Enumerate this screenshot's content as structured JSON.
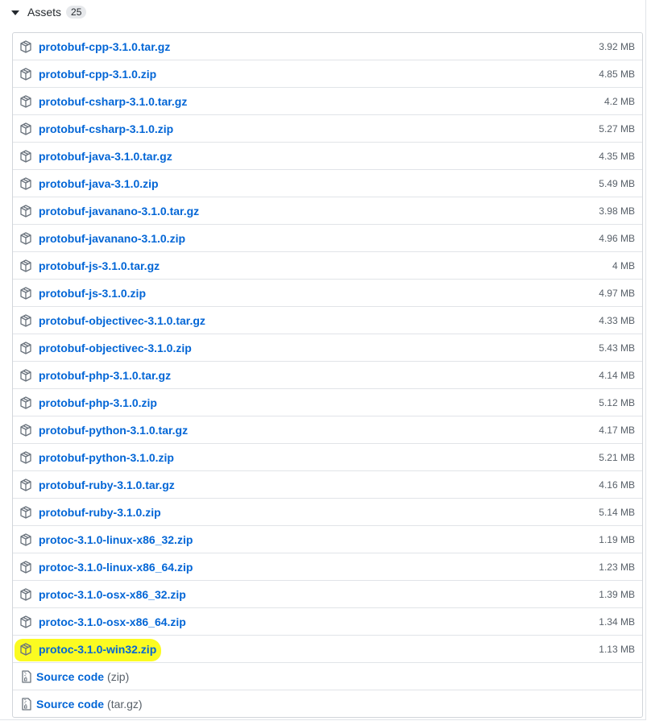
{
  "assets": {
    "title": "Assets",
    "count": "25",
    "items": [
      {
        "name": "protobuf-cpp-3.1.0.tar.gz",
        "size": "3.92 MB"
      },
      {
        "name": "protobuf-cpp-3.1.0.zip",
        "size": "4.85 MB"
      },
      {
        "name": "protobuf-csharp-3.1.0.tar.gz",
        "size": "4.2 MB"
      },
      {
        "name": "protobuf-csharp-3.1.0.zip",
        "size": "5.27 MB"
      },
      {
        "name": "protobuf-java-3.1.0.tar.gz",
        "size": "4.35 MB"
      },
      {
        "name": "protobuf-java-3.1.0.zip",
        "size": "5.49 MB"
      },
      {
        "name": "protobuf-javanano-3.1.0.tar.gz",
        "size": "3.98 MB"
      },
      {
        "name": "protobuf-javanano-3.1.0.zip",
        "size": "4.96 MB"
      },
      {
        "name": "protobuf-js-3.1.0.tar.gz",
        "size": "4 MB"
      },
      {
        "name": "protobuf-js-3.1.0.zip",
        "size": "4.97 MB"
      },
      {
        "name": "protobuf-objectivec-3.1.0.tar.gz",
        "size": "4.33 MB"
      },
      {
        "name": "protobuf-objectivec-3.1.0.zip",
        "size": "5.43 MB"
      },
      {
        "name": "protobuf-php-3.1.0.tar.gz",
        "size": "4.14 MB"
      },
      {
        "name": "protobuf-php-3.1.0.zip",
        "size": "5.12 MB"
      },
      {
        "name": "protobuf-python-3.1.0.tar.gz",
        "size": "4.17 MB"
      },
      {
        "name": "protobuf-python-3.1.0.zip",
        "size": "5.21 MB"
      },
      {
        "name": "protobuf-ruby-3.1.0.tar.gz",
        "size": "4.16 MB"
      },
      {
        "name": "protobuf-ruby-3.1.0.zip",
        "size": "5.14 MB"
      },
      {
        "name": "protoc-3.1.0-linux-x86_32.zip",
        "size": "1.19 MB"
      },
      {
        "name": "protoc-3.1.0-linux-x86_64.zip",
        "size": "1.23 MB"
      },
      {
        "name": "protoc-3.1.0-osx-x86_32.zip",
        "size": "1.39 MB"
      },
      {
        "name": "protoc-3.1.0-osx-x86_64.zip",
        "size": "1.34 MB"
      },
      {
        "name": "protoc-3.1.0-win32.zip",
        "size": "1.13 MB",
        "highlighted": true
      }
    ],
    "source": [
      {
        "label": "Source code",
        "ext": "(zip)"
      },
      {
        "label": "Source code",
        "ext": "(tar.gz)"
      }
    ]
  },
  "colors": {
    "link": "#0366d6",
    "muted": "#586069",
    "highlight": "#fbfb21"
  }
}
